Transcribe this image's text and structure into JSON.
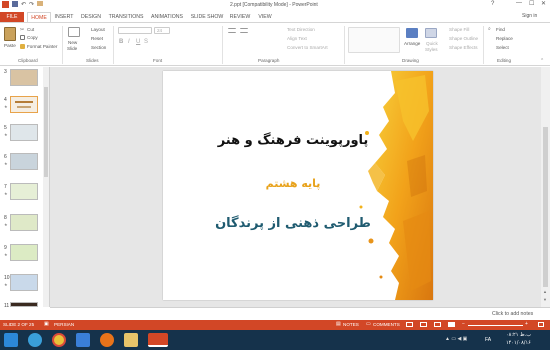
{
  "window": {
    "title": "2.ppt [Compatibility Mode] - PowerPoint",
    "signin": "Sign in",
    "help": "?"
  },
  "tabs": [
    "FILE",
    "HOME",
    "INSERT",
    "DESIGN",
    "TRANSITIONS",
    "ANIMATIONS",
    "SLIDE SHOW",
    "REVIEW",
    "VIEW"
  ],
  "ribbon": {
    "clipboard": {
      "paste": "Paste",
      "cut": "Cut",
      "copy": "Copy",
      "format_painter": "Format Painter",
      "label": "Clipboard"
    },
    "slides": {
      "new_slide": "New",
      "new_slide2": "Slide",
      "layout": "Layout",
      "reset": "Reset",
      "section": "Section",
      "label": "Slides"
    },
    "font": {
      "size": "24",
      "bold": "B",
      "italic": "I",
      "underline": "U",
      "strike": "S",
      "label": "Font"
    },
    "paragraph": {
      "text_direction": "Text Direction",
      "align_text": "Align Text",
      "smartart": "Convert to SmartArt",
      "label": "Paragraph"
    },
    "drawing": {
      "arrange": "Arrange",
      "quick_styles": "Quick",
      "quick_styles2": "Styles",
      "shape_fill": "Shape Fill",
      "shape_outline": "Shape Outline",
      "shape_effects": "Shape Effects",
      "label": "Drawing"
    },
    "editing": {
      "find": "Find",
      "replace": "Replace",
      "select": "Select",
      "label": "Editing"
    }
  },
  "thumbnails": [
    {
      "num": "3"
    },
    {
      "num": "4"
    },
    {
      "num": "5"
    },
    {
      "num": "6"
    },
    {
      "num": "7"
    },
    {
      "num": "8"
    },
    {
      "num": "9"
    },
    {
      "num": "10"
    },
    {
      "num": "11"
    }
  ],
  "slide": {
    "title": "پاورپوینت فرهنگ و هنر",
    "subtitle": "پایه هشتم",
    "body": "طراحی ذهنی از پرندگان"
  },
  "notes_placeholder": "Click to add notes",
  "status": {
    "slide_of": "SLIDE 2 OF 25",
    "language": "PERSIAN",
    "notes": "NOTES",
    "comments": "COMMENTS"
  },
  "taskbar": {
    "lang": "FA",
    "time": "۰۸:۲۱ ب.ظ",
    "date": "۱۴۰۱/۰۸/۱۶"
  },
  "colors": {
    "accent": "#d24726",
    "slide_gold": "#f2b21a",
    "subtitle": "#e8a21b",
    "taskbar": "#15324b"
  }
}
